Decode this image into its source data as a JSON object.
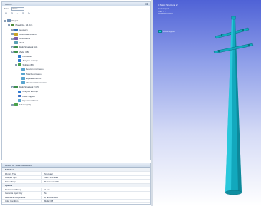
{
  "outline": {
    "title": "Outline",
    "pin_glyph": "✖",
    "filter_label": "Filter",
    "filter_value": "Name",
    "toolbar": [
      {
        "name": "expand-all-icon",
        "glyph": "⊞"
      },
      {
        "name": "collapse-all-icon",
        "glyph": "⊟"
      },
      {
        "name": "search-icon",
        "glyph": "⌕"
      },
      {
        "name": "sort-icon",
        "glyph": "⇅"
      },
      {
        "name": "refresh-icon",
        "glyph": "↻"
      }
    ],
    "tree": [
      {
        "label": "Project",
        "level": 0,
        "icon": "project",
        "twisty": "−"
      },
      {
        "label": "Model (A4, B4, C4)",
        "level": 1,
        "icon": "model",
        "twisty": "−"
      },
      {
        "label": "Geometry",
        "level": 2,
        "icon": "geom",
        "twisty": "+"
      },
      {
        "label": "Coordinate Systems",
        "level": 2,
        "icon": "coord",
        "twisty": "+"
      },
      {
        "label": "Connections",
        "level": 2,
        "icon": "conn",
        "twisty": "+"
      },
      {
        "label": "Mesh",
        "level": 2,
        "icon": "mesh",
        "twisty": ""
      },
      {
        "label": "Static Structural (A5)",
        "level": 2,
        "icon": "analysis",
        "twisty": "−"
      },
      {
        "label": "Modal (B5)",
        "level": 2,
        "icon": "analysis",
        "twisty": "−"
      },
      {
        "label": "Pre-Stress",
        "level": 3,
        "icon": "support",
        "twisty": ""
      },
      {
        "label": "Analysis Settings",
        "level": 3,
        "icon": "support",
        "twisty": ""
      },
      {
        "label": "Solution (B6)",
        "level": 3,
        "icon": "sol",
        "twisty": "−"
      },
      {
        "label": "Solution Information",
        "level": 4,
        "icon": "res",
        "twisty": ""
      },
      {
        "label": "Total Deformation",
        "level": 4,
        "icon": "res",
        "twisty": ""
      },
      {
        "label": "Equivalent Stress",
        "level": 4,
        "icon": "res",
        "twisty": ""
      },
      {
        "label": "Directional Deformation",
        "level": 4,
        "icon": "res",
        "twisty": ""
      },
      {
        "label": "Static Structural 2 (C5)",
        "level": 2,
        "icon": "analysis",
        "twisty": "−"
      },
      {
        "label": "Analysis Settings",
        "level": 3,
        "icon": "support",
        "twisty": ""
      },
      {
        "label": "Fixed Support",
        "level": 3,
        "icon": "fixed",
        "twisty": ""
      },
      {
        "label": "Equivalent Stress",
        "level": 3,
        "icon": "res",
        "twisty": ""
      },
      {
        "label": "Solution (C6)",
        "level": 2,
        "icon": "sol",
        "twisty": "+"
      }
    ]
  },
  "details": {
    "title": "Details of \"Static Structural 2\"",
    "rows": [
      {
        "k": "Definition",
        "v": "",
        "section": true
      },
      {
        "k": "Physics Type",
        "v": "Structural",
        "section": false
      },
      {
        "k": "Analysis Type",
        "v": "Static Structural",
        "section": false
      },
      {
        "k": "Solver Target",
        "v": "Mechanical APDL",
        "section": false
      },
      {
        "k": "Options",
        "v": "",
        "section": true
      },
      {
        "k": "Environment Temp.",
        "v": "22. °C",
        "section": false
      },
      {
        "k": "Generate Input Only",
        "v": "No",
        "section": false
      },
      {
        "k": "Reference Temperature",
        "v": "By Environment",
        "section": false
      },
      {
        "k": "Initial Condition",
        "v": "Modal (B5)",
        "section": false
      }
    ]
  },
  "viewport": {
    "title": "C: Static Structural 2",
    "lines": [
      "Fixed Support",
      "Time: 1. s",
      "2/7/2019 10:52 AM"
    ],
    "legend_label": "Fixed Support",
    "colors": {
      "pole": "#12a8bd",
      "pole_dark": "#0a6f80",
      "pole_light": "#33d6ea",
      "legend": "#19d4ee"
    }
  }
}
